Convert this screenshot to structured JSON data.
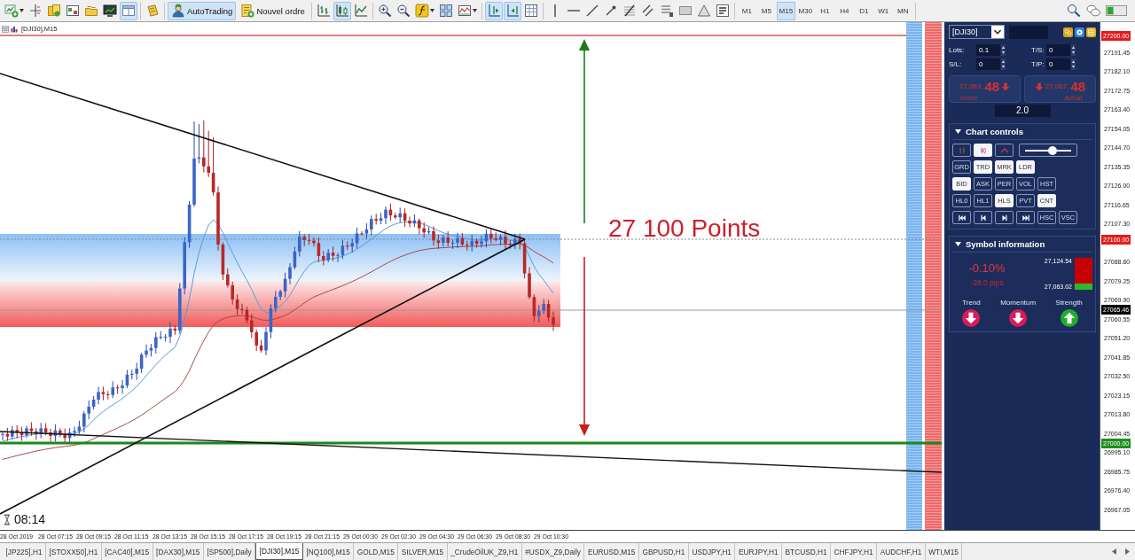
{
  "toolbar": {
    "groups": [
      {
        "buttons": [
          {
            "kind": "icon",
            "selected": false,
            "dropdown": true
          },
          {
            "kind": "icon",
            "selected": false,
            "dropdown": false
          },
          {
            "kind": "icon",
            "selected": false,
            "dropdown": false
          },
          {
            "kind": "icon",
            "selected": false,
            "dropdown": false
          },
          {
            "kind": "icon",
            "selected": false,
            "dropdown": false
          },
          {
            "kind": "icon",
            "selected": false,
            "dropdown": false
          },
          {
            "kind": "icon",
            "selected": true,
            "dropdown": false
          }
        ]
      },
      {
        "buttons": [
          {
            "kind": "icon",
            "selected": false,
            "dropdown": false
          }
        ]
      },
      {
        "buttons": [
          {
            "kind": "labeled",
            "label": "AutoTrading",
            "selected": true,
            "dropdown": false
          },
          {
            "kind": "labeled",
            "label": "Nouvel ordre",
            "selected": false,
            "dropdown": false
          }
        ]
      },
      {
        "buttons": [
          {
            "kind": "icon",
            "selected": false,
            "dropdown": false
          },
          {
            "kind": "icon",
            "selected": true,
            "dropdown": false
          },
          {
            "kind": "icon",
            "selected": false,
            "dropdown": false
          }
        ]
      },
      {
        "buttons": [
          {
            "kind": "icon",
            "selected": false,
            "dropdown": false
          },
          {
            "kind": "icon",
            "selected": false,
            "dropdown": false
          },
          {
            "kind": "icon",
            "selected": false,
            "dropdown": true
          },
          {
            "kind": "icon",
            "selected": false,
            "dropdown": false
          },
          {
            "kind": "icon",
            "selected": false,
            "dropdown": true
          }
        ]
      },
      {
        "buttons": [
          {
            "kind": "icon",
            "selected": true,
            "dropdown": false
          },
          {
            "kind": "icon",
            "selected": true,
            "dropdown": false
          },
          {
            "kind": "icon",
            "selected": false,
            "dropdown": false
          }
        ]
      },
      {
        "buttons": [
          {
            "kind": "icon",
            "selected": false,
            "dropdown": false
          },
          {
            "kind": "icon",
            "selected": false,
            "dropdown": false
          },
          {
            "kind": "icon",
            "selected": false,
            "dropdown": false
          },
          {
            "kind": "icon",
            "selected": false,
            "dropdown": false
          },
          {
            "kind": "icon",
            "selected": false,
            "dropdown": false
          },
          {
            "kind": "icon",
            "selected": false,
            "dropdown": false
          },
          {
            "kind": "icon",
            "selected": false,
            "dropdown": false
          },
          {
            "kind": "icon",
            "selected": false,
            "dropdown": false
          },
          {
            "kind": "icon",
            "selected": false,
            "dropdown": false
          },
          {
            "kind": "icon",
            "selected": false,
            "dropdown": false
          }
        ]
      }
    ],
    "timeframes": [
      {
        "label": "M1",
        "selected": false
      },
      {
        "label": "M5",
        "selected": false
      },
      {
        "label": "M15",
        "selected": true
      },
      {
        "label": "M30",
        "selected": false
      },
      {
        "label": "H1",
        "selected": false
      },
      {
        "label": "H4",
        "selected": false
      },
      {
        "label": "D1",
        "selected": false
      },
      {
        "label": "W1",
        "selected": false
      },
      {
        "label": "MN",
        "selected": false
      }
    ]
  },
  "chart": {
    "title": "[DJI30],M15",
    "annotation": "27 100 Points",
    "timer": "08:14",
    "price_axis": {
      "ticks": [
        "27191.45",
        "27182.10",
        "27172.75",
        "27163.40",
        "27154.05",
        "27144.70",
        "27135.35",
        "27126.00",
        "27116.65",
        "27107.30",
        "27088.60",
        "27079.25",
        "27069.90",
        "27060.55",
        "27051.20",
        "27041.85",
        "27032.50",
        "27023.15",
        "27013.80",
        "27004.45",
        "26995.10",
        "26985.75",
        "26976.40",
        "26967.05"
      ],
      "markers": [
        {
          "label": "27200.00",
          "color": "#e31b1b"
        },
        {
          "label": "27100.00",
          "color": "#e31b1b"
        },
        {
          "label": "27065.46",
          "color": "#000000"
        },
        {
          "label": "27000.00",
          "color": "#1f8f1f"
        }
      ]
    },
    "time_axis": {
      "ticks": [
        "28 Oct 2019",
        "28 Oct 07:15",
        "28 Oct 09:15",
        "28 Oct 11:15",
        "28 Oct 13:15",
        "28 Oct 15:15",
        "28 Oct 17:15",
        "28 Oct 19:15",
        "28 Oct 21:15",
        "29 Oct 00:30",
        "29 Oct 02:30",
        "29 Oct 04:30",
        "29 Oct 06:30",
        "29 Oct 08:30",
        "29 Oct 10:30"
      ]
    }
  },
  "trade_panel": {
    "symbol": "[DJI30]",
    "fields": [
      {
        "label": "Lots:",
        "value": "0.1"
      },
      {
        "label": "T/S:",
        "value": "0"
      },
      {
        "label": "S/L:",
        "value": "0"
      },
      {
        "label": "T/P:",
        "value": "0"
      }
    ],
    "sell": {
      "price": "27,063.",
      "pips": "48",
      "label": "Vente"
    },
    "buy": {
      "price": "27,067.",
      "pips": "48",
      "label": "Achat"
    },
    "spread": "2.0"
  },
  "chart_controls": {
    "title": "Chart controls",
    "expanded": true,
    "rows": [
      {
        "buttons": [
          {
            "kind": "icon",
            "selected": false
          },
          {
            "kind": "icon",
            "selected": true
          },
          {
            "kind": "icon",
            "selected": false
          },
          {
            "kind": "slider",
            "level": 0.6
          }
        ]
      },
      {
        "buttons": [
          {
            "kind": "text",
            "label": "GRD",
            "selected": false
          },
          {
            "kind": "text",
            "label": "TRD",
            "selected": true
          },
          {
            "kind": "text",
            "label": "MRK",
            "selected": true
          },
          {
            "kind": "text",
            "label": "LDR",
            "selected": true
          }
        ]
      },
      {
        "buttons": [
          {
            "kind": "text",
            "label": "BID",
            "selected": true
          },
          {
            "kind": "text",
            "label": "ASK",
            "selected": false
          },
          {
            "kind": "text",
            "label": "PER",
            "selected": false
          },
          {
            "kind": "text",
            "label": "VOL",
            "selected": false
          },
          {
            "kind": "text",
            "label": "HST",
            "selected": false
          }
        ]
      },
      {
        "buttons": [
          {
            "kind": "text",
            "label": "HL0",
            "selected": false
          },
          {
            "kind": "text",
            "label": "HL1",
            "selected": false
          },
          {
            "kind": "text",
            "label": "HLS",
            "selected": true
          },
          {
            "kind": "text",
            "label": "PVT",
            "selected": false
          },
          {
            "kind": "text",
            "label": "CNT",
            "selected": true
          }
        ]
      },
      {
        "buttons": [
          {
            "kind": "icon",
            "selected": false
          },
          {
            "kind": "icon",
            "selected": false
          },
          {
            "kind": "icon",
            "selected": false
          },
          {
            "kind": "icon",
            "selected": false
          },
          {
            "kind": "text",
            "label": "HSC",
            "selected": false
          },
          {
            "kind": "text",
            "label": "VSC",
            "selected": false
          }
        ]
      }
    ]
  },
  "symbol_info": {
    "title": "Symbol information",
    "expanded": true,
    "change": "-0.10%",
    "pips": "-28.0 pips",
    "high": "27,124.54",
    "low": "27,063.02",
    "level": 0.2,
    "indicators": [
      {
        "label": "Trend",
        "rising": false
      },
      {
        "label": "Momentum",
        "rising": false
      },
      {
        "label": "Strength",
        "rising": true
      }
    ]
  },
  "tabs": [
    {
      "label": "[JP225],H1",
      "selected": false
    },
    {
      "label": "[STOXX50],H1",
      "selected": false
    },
    {
      "label": "[CAC40],M15",
      "selected": false
    },
    {
      "label": "[DAX30],M15",
      "selected": false
    },
    {
      "label": "[SP500],Daily",
      "selected": false
    },
    {
      "label": "[DJI30],M15",
      "selected": true
    },
    {
      "label": "[NQ100],M15",
      "selected": false
    },
    {
      "label": "GOLD,M15",
      "selected": false
    },
    {
      "label": "SILVER,M15",
      "selected": false
    },
    {
      "label": "_CrudeOilUK_Z9,H1",
      "selected": false
    },
    {
      "label": "#USDX_Z9,Daily",
      "selected": false
    },
    {
      "label": "EURUSD,M15",
      "selected": false
    },
    {
      "label": "GBPUSD,H1",
      "selected": false
    },
    {
      "label": "USDJPY,H1",
      "selected": false
    },
    {
      "label": "EURJPY,H1",
      "selected": false
    },
    {
      "label": "BTCUSD,H1",
      "selected": false
    },
    {
      "label": "CHFJPY,H1",
      "selected": false
    },
    {
      "label": "AUDCHF,H1",
      "selected": false
    },
    {
      "label": "WTI,M15",
      "selected": false
    }
  ]
}
